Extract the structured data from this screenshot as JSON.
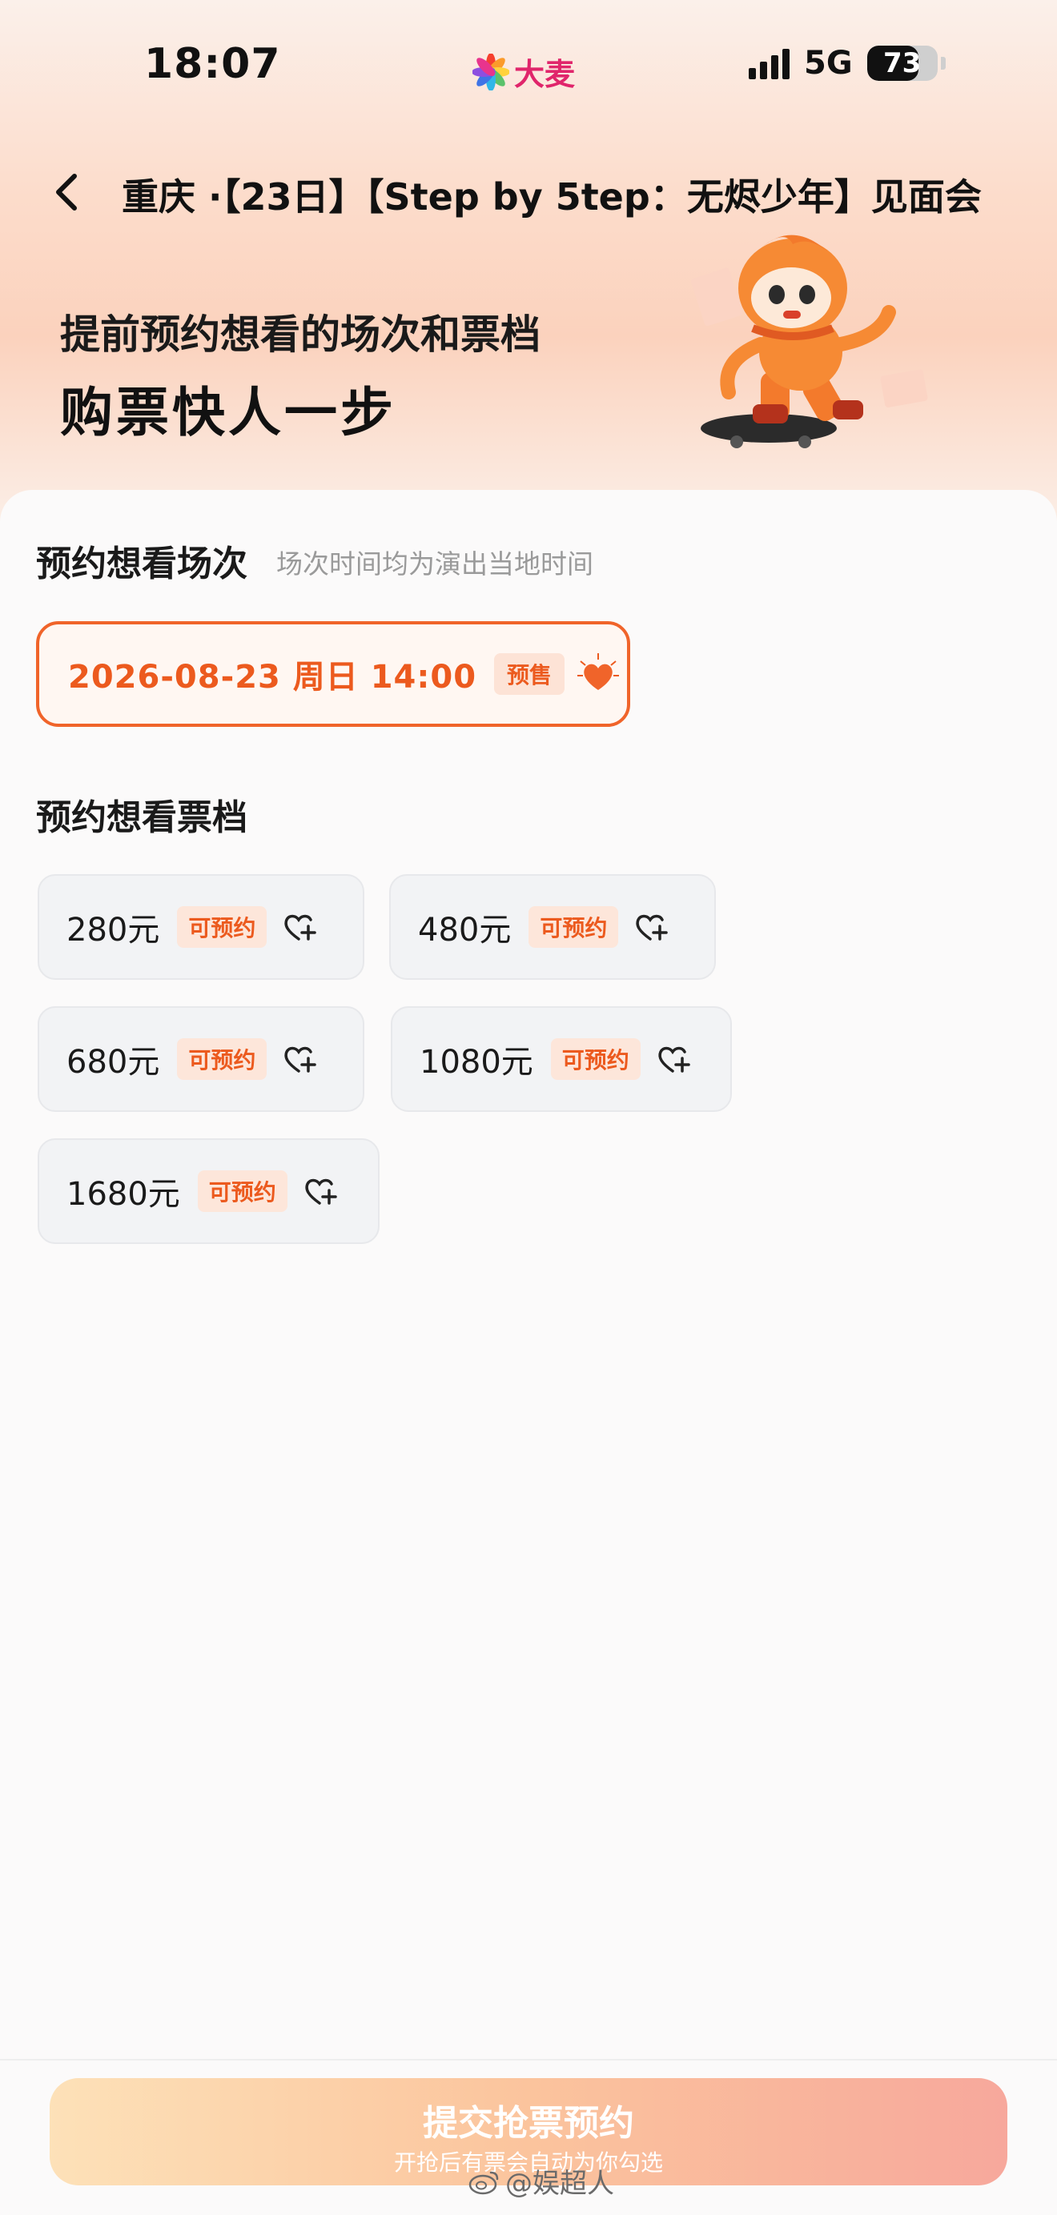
{
  "status_bar": {
    "time": "18:07",
    "app_name": "大麦",
    "network": "5G",
    "battery": "73",
    "battery_level": 0.73,
    "signal_icon": "cellular-signal-icon"
  },
  "header": {
    "title": "重庆 ·【23日】【Step by 5tep：无烬少年】见面会",
    "back_icon": "chevron-left-icon"
  },
  "hero": {
    "line1": "提前预约想看的场次和票档",
    "line2": "购票快人一步",
    "mascot_icon": "skateboard-mascot-icon"
  },
  "session_section": {
    "title": "预约想看场次",
    "subtitle": "场次时间均为演出当地时间",
    "selected": {
      "label": "2026-08-23  周日 14:00",
      "badge": "预售",
      "icon": "heart-icon"
    }
  },
  "tier_section": {
    "title": "预约想看票档",
    "tiers": [
      {
        "price": "280元",
        "badge": "可预约"
      },
      {
        "price": "480元",
        "badge": "可预约"
      },
      {
        "price": "680元",
        "badge": "可预约"
      },
      {
        "price": "1080元",
        "badge": "可预约"
      },
      {
        "price": "1680元",
        "badge": "可预约"
      }
    ],
    "tier_icon": "heart-plus-icon"
  },
  "footer": {
    "submit_label": "提交抢票预约",
    "submit_sub": "开抢后有票会自动为你勾选",
    "watermark": "@娱超人"
  },
  "colors": {
    "accent": "#ec5a1e",
    "badge_bg": "#fde3d6",
    "tier_bg": "#f2f3f5"
  }
}
